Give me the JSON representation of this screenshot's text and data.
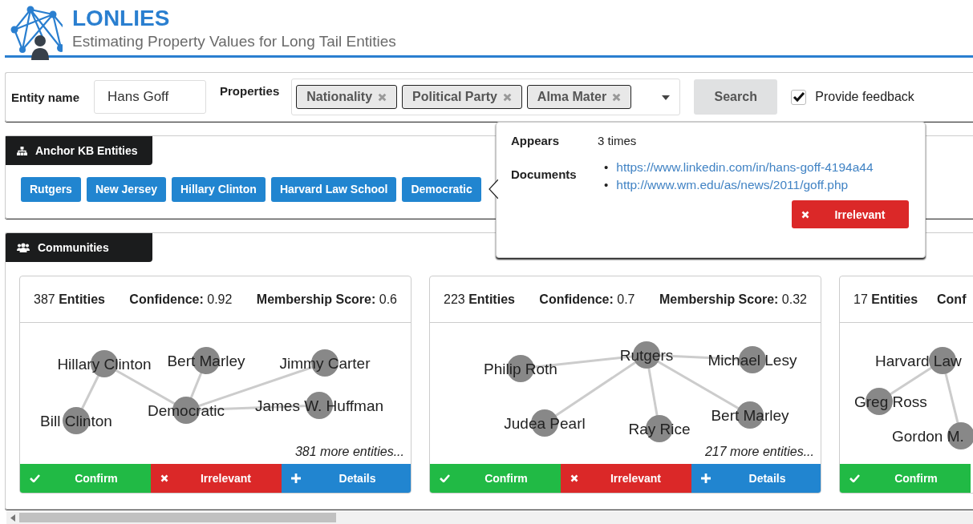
{
  "header": {
    "title": "LONLIES",
    "subtitle": "Estimating Property Values for Long Tail Entities"
  },
  "search": {
    "entity_label": "Entity name",
    "entity_value": "Hans Goff",
    "properties_label": "Properties",
    "properties": [
      "Nationality",
      "Political Party",
      "Alma Mater"
    ],
    "button": "Search",
    "feedback": {
      "label": "Provide feedback",
      "checked": true
    }
  },
  "anchor": {
    "title": "Anchor KB Entities",
    "entities": [
      "Rutgers",
      "New Jersey",
      "Hillary Clinton",
      "Harvard Law School",
      "Democratic"
    ]
  },
  "popover": {
    "appears_label": "Appears",
    "appears_value": "3 times",
    "documents_label": "Documents",
    "documents": [
      {
        "marker": "•",
        "link": "https://www.linkedin.com/in/hans-goff-4194a44"
      },
      {
        "marker": "•",
        "link": "http://www.wm.edu/as/news/2011/goff.php"
      }
    ],
    "button": "Irrelevant"
  },
  "communities": {
    "title": "Communities",
    "cards": [
      {
        "stats": [
          {
            "value": "387",
            "label": "Entities"
          },
          {
            "label": "Confidence:",
            "value": "0.92"
          },
          {
            "label": "Membership Score:",
            "value": "0.6"
          }
        ],
        "nodes": [
          "Hillary Clinton",
          "Bert Marley",
          "Jimmy Carter",
          "Bill Clinton",
          "Democratic",
          "James W. Huffman"
        ],
        "more": "381 more entities...",
        "buttons": [
          {
            "kind": "confirm",
            "label": "Confirm"
          },
          {
            "kind": "irrelevant",
            "label": "Irrelevant"
          },
          {
            "kind": "details",
            "label": "Details"
          }
        ]
      },
      {
        "stats": [
          {
            "value": "223",
            "label": "Entities"
          },
          {
            "label": "Confidence:",
            "value": "0.7"
          },
          {
            "label": "Membership Score:",
            "value": "0.32"
          }
        ],
        "nodes": [
          "Philip Roth",
          "Rutgers",
          "Michael Lesy",
          "Judea Pearl",
          "Ray Rice",
          "Bert Marley"
        ],
        "more": "217 more entities...",
        "buttons": [
          {
            "kind": "confirm",
            "label": "Confirm"
          },
          {
            "kind": "irrelevant",
            "label": "Irrelevant"
          },
          {
            "kind": "details",
            "label": "Details"
          }
        ]
      },
      {
        "stats": [
          {
            "value": "17",
            "label": "Entities"
          },
          {
            "label": "Conf"
          }
        ],
        "nodes": [
          "Harvard Law",
          "Greg Ross",
          "Gordon M."
        ],
        "buttons": [
          {
            "kind": "confirm",
            "label": "Confirm"
          }
        ]
      }
    ]
  }
}
